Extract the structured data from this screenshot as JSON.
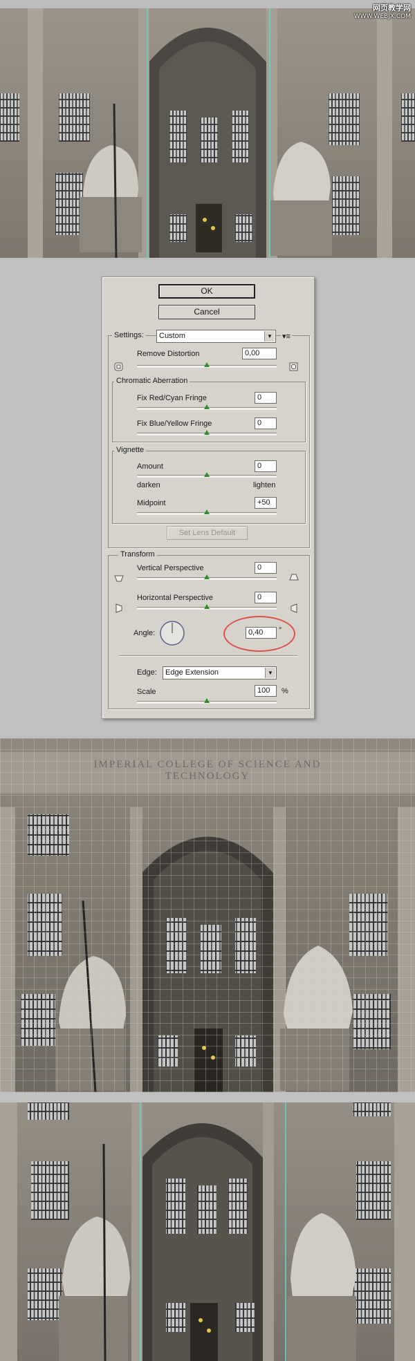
{
  "watermark": {
    "title": "网页教学网",
    "url": "WWW.WEBJX.COM"
  },
  "photo3": {
    "inscription": "IMPERIAL COLLEGE OF SCIENCE AND TECHNOLOGY"
  },
  "dialog": {
    "ok_label": "OK",
    "cancel_label": "Cancel",
    "settings": {
      "label": "Settings:",
      "value": "Custom"
    },
    "remove_distortion": {
      "label": "Remove Distortion",
      "value": "0,00",
      "level": 0.5
    },
    "chromatic": {
      "legend": "Chromatic Aberration",
      "red_cyan": {
        "label": "Fix Red/Cyan Fringe",
        "value": "0"
      },
      "blue_yellow": {
        "label": "Fix Blue/Yellow Fringe",
        "value": "0"
      }
    },
    "vignette": {
      "legend": "Vignette",
      "amount": {
        "label": "Amount",
        "value": "0"
      },
      "darken_label": "darken",
      "lighten_label": "lighten",
      "midpoint": {
        "label": "Midpoint",
        "value": "+50"
      }
    },
    "set_lens_default_label": "Set Lens Default",
    "transform": {
      "legend": "Transform",
      "vertical": {
        "label": "Vertical Perspective",
        "value": "0"
      },
      "horizontal": {
        "label": "Horizontal Perspective",
        "value": "0"
      },
      "angle": {
        "label": "Angle:",
        "value": "0,40",
        "unit": "°"
      }
    },
    "edge": {
      "label": "Edge:",
      "value": "Edge Extension"
    },
    "scale": {
      "label": "Scale",
      "value": "100",
      "unit": "%"
    }
  },
  "colors": {
    "dialog_bg": "#d6d3cc",
    "annotation": "#e0504c",
    "guide": "#5fd6d0",
    "slider_thumb": "#2f8f2a"
  }
}
